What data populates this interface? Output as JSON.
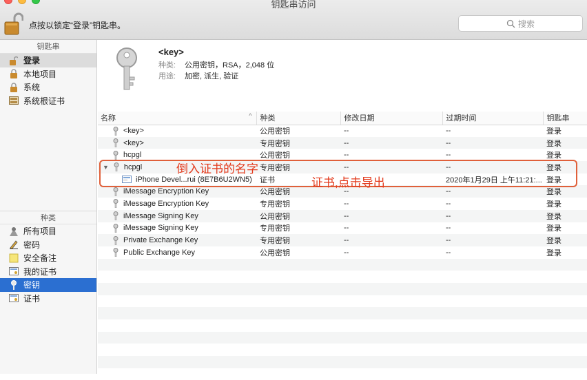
{
  "window": {
    "title": "钥匙串访问"
  },
  "toolbar": {
    "lock_text": "点按以锁定“登录”钥匙串。",
    "search_placeholder": "搜索"
  },
  "sidebar": {
    "keychains_header": "钥匙串",
    "keychains": [
      {
        "label": "登录",
        "icon": "lock-open-icon"
      },
      {
        "label": "本地项目",
        "icon": "lock-icon"
      },
      {
        "label": "系统",
        "icon": "lock-icon"
      },
      {
        "label": "系统根证书",
        "icon": "cabinet-icon"
      }
    ],
    "kinds_header": "种类",
    "kinds": [
      {
        "label": "所有项目",
        "icon": "people-icon"
      },
      {
        "label": "密码",
        "icon": "pencil-icon"
      },
      {
        "label": "安全备注",
        "icon": "note-icon"
      },
      {
        "label": "我的证书",
        "icon": "certificate-icon"
      },
      {
        "label": "密钥",
        "icon": "key-icon"
      },
      {
        "label": "证书",
        "icon": "certificate-icon"
      }
    ]
  },
  "detail": {
    "title": "<key>",
    "kind_label": "种类:",
    "kind_value": "公用密钥，RSA，2,048 位",
    "usage_label": "用途:",
    "usage_value": "加密, 派生, 验证"
  },
  "table": {
    "columns": [
      "名称",
      "种类",
      "修改日期",
      "过期时间",
      "钥匙串"
    ],
    "rows": [
      {
        "name": "<key>",
        "kind": "公用密钥",
        "modified": "--",
        "expires": "--",
        "keychain": "登录",
        "icon": "key-icon"
      },
      {
        "name": "<key>",
        "kind": "专用密钥",
        "modified": "--",
        "expires": "--",
        "keychain": "登录",
        "icon": "key-icon"
      },
      {
        "name": "hcpgl",
        "kind": "公用密钥",
        "modified": "--",
        "expires": "--",
        "keychain": "登录",
        "icon": "key-icon"
      },
      {
        "name": "hcpgl",
        "kind": "专用密钥",
        "modified": "--",
        "expires": "--",
        "keychain": "登录",
        "icon": "key-icon",
        "disclosure": "▼"
      },
      {
        "name": "iPhone Devel...rui (8E7B6U2WN5)",
        "kind": "证书",
        "modified": "",
        "expires": "2020年1月29日 上午11:21:...",
        "keychain": "登录",
        "icon": "certificate-icon",
        "indent": true
      },
      {
        "name": "iMessage Encryption Key",
        "kind": "公用密钥",
        "modified": "--",
        "expires": "--",
        "keychain": "登录",
        "icon": "key-icon"
      },
      {
        "name": "iMessage Encryption Key",
        "kind": "专用密钥",
        "modified": "--",
        "expires": "--",
        "keychain": "登录",
        "icon": "key-icon"
      },
      {
        "name": "iMessage Signing Key",
        "kind": "公用密钥",
        "modified": "--",
        "expires": "--",
        "keychain": "登录",
        "icon": "key-icon"
      },
      {
        "name": "iMessage Signing Key",
        "kind": "专用密钥",
        "modified": "--",
        "expires": "--",
        "keychain": "登录",
        "icon": "key-icon"
      },
      {
        "name": "Private Exchange Key",
        "kind": "专用密钥",
        "modified": "--",
        "expires": "--",
        "keychain": "登录",
        "icon": "key-icon"
      },
      {
        "name": "Public Exchange Key",
        "kind": "公用密钥",
        "modified": "--",
        "expires": "--",
        "keychain": "登录",
        "icon": "key-icon"
      }
    ]
  },
  "annotations": {
    "label1": "倒入证书的名字",
    "label2": "证书,点击导出",
    "color": "#e33a1c"
  },
  "colors": {
    "selection": "#2b6fd1",
    "annotation_box": "#e0603a"
  }
}
